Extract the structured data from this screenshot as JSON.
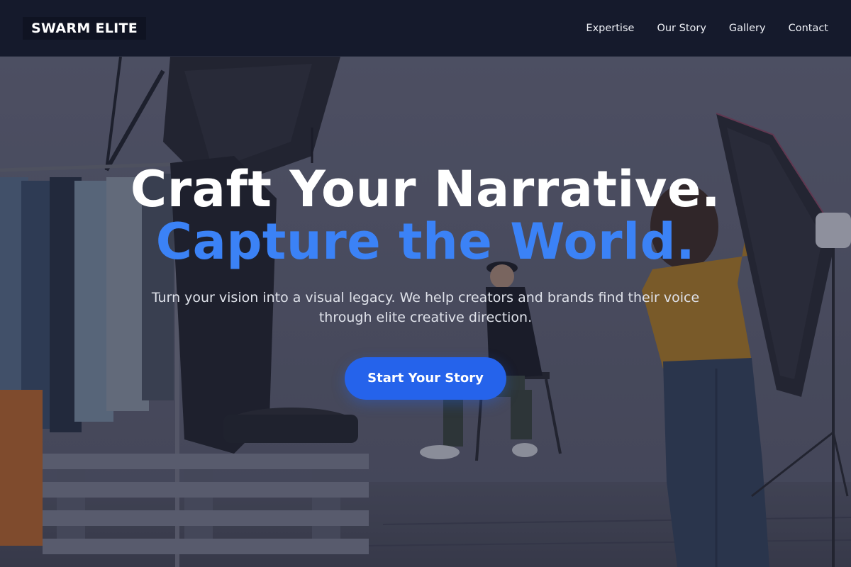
{
  "brand": {
    "name": "SWARM ELITE"
  },
  "nav": {
    "links": [
      {
        "label": "Expertise"
      },
      {
        "label": "Our Story"
      },
      {
        "label": "Gallery"
      },
      {
        "label": "Contact"
      }
    ]
  },
  "hero": {
    "headline_line1": "Craft Your Narrative.",
    "headline_line2": "Capture the World.",
    "subtitle": "Turn your vision into a visual legacy. We help creators and brands find their voice through elite creative direction.",
    "cta_label": "Start Your Story",
    "accent_color": "#3b82f6",
    "button_color": "#2563eb"
  }
}
